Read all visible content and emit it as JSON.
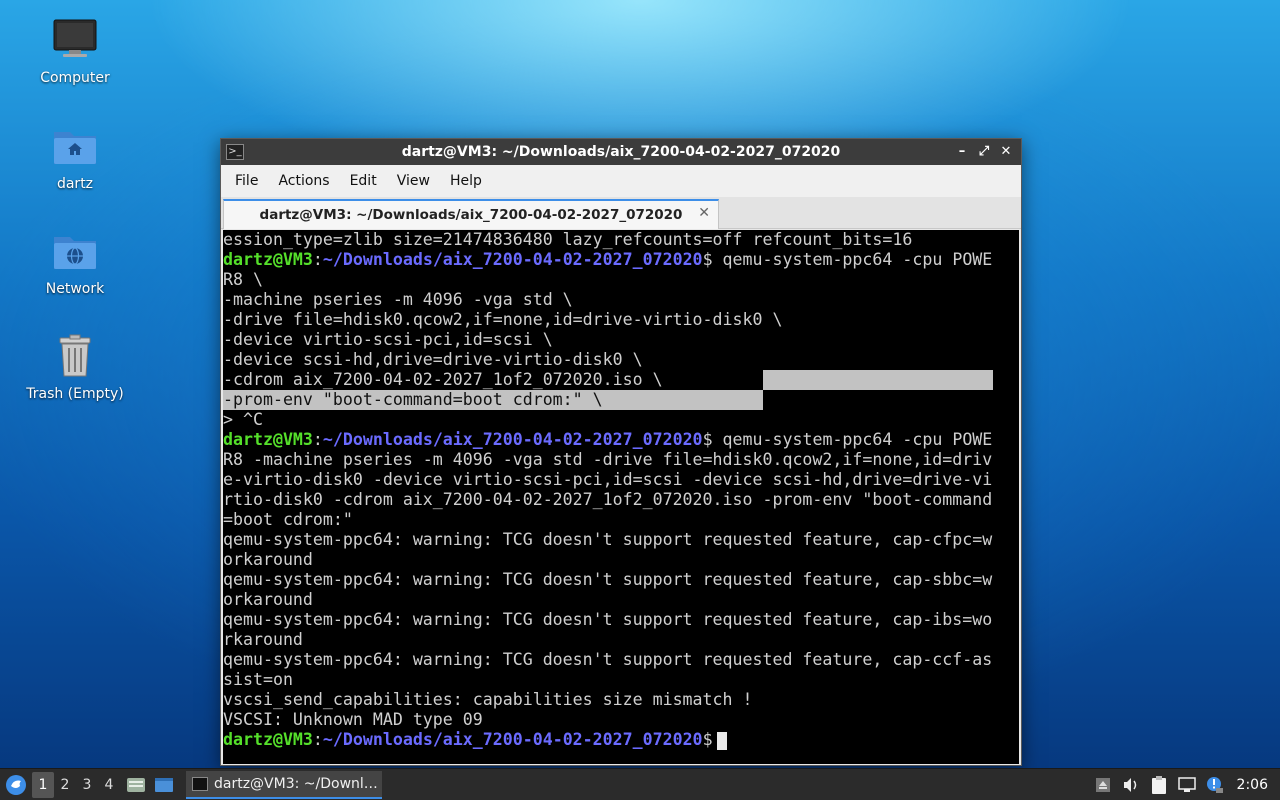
{
  "desktop": {
    "icons": [
      {
        "label": "Computer",
        "icon": "computer-icon"
      },
      {
        "label": "dartz",
        "icon": "home-folder-icon"
      },
      {
        "label": "Network",
        "icon": "network-folder-icon"
      },
      {
        "label": "Trash (Empty)",
        "icon": "trash-icon"
      }
    ]
  },
  "window": {
    "title": "dartz@VM3: ~/Downloads/aix_7200-04-02-2027_072020",
    "controls": {
      "minimize": "–",
      "maximize": "⤢",
      "close": "✕"
    },
    "menu": [
      "File",
      "Actions",
      "Edit",
      "View",
      "Help"
    ],
    "tab": {
      "label": "dartz@VM3: ~/Downloads/aix_7200-04-02-2027_072020",
      "close": "✕"
    }
  },
  "terminal": {
    "user": "dartz@VM3",
    "path": "~/Downloads/aix_7200-04-02-2027_072020",
    "lines": {
      "l0": "ession_type=zlib size=21474836480 lazy_refcounts=off refcount_bits=16",
      "l1_cmd": " qemu-system-ppc64 -cpu POWE",
      "l2": "R8 \\",
      "l3": "-machine pseries -m 4096 -vga std \\",
      "l4": "-drive file=hdisk0.qcow2,if=none,id=drive-virtio-disk0 \\",
      "l5": "-device virtio-scsi-pci,id=scsi \\",
      "l6": "-device scsi-hd,drive=drive-virtio-disk0 \\",
      "l7": "-cdrom aix_7200-04-02-2027_1of2_072020.iso \\",
      "l8": "-prom-env \"boot-command=boot cdrom:\" \\",
      "l9": "> ^C",
      "l10_cmd": " qemu-system-ppc64 -cpu POWE",
      "l11": "R8 -machine pseries -m 4096 -vga std -drive file=hdisk0.qcow2,if=none,id=driv",
      "l12": "e-virtio-disk0 -device virtio-scsi-pci,id=scsi -device scsi-hd,drive=drive-vi",
      "l13": "rtio-disk0 -cdrom aix_7200-04-02-2027_1of2_072020.iso -prom-env \"boot-command",
      "l14": "=boot cdrom:\"",
      "l15": "qemu-system-ppc64: warning: TCG doesn't support requested feature, cap-cfpc=w",
      "l16": "orkaround",
      "l17": "qemu-system-ppc64: warning: TCG doesn't support requested feature, cap-sbbc=w",
      "l18": "orkaround",
      "l19": "qemu-system-ppc64: warning: TCG doesn't support requested feature, cap-ibs=wo",
      "l20": "rkaround",
      "l21": "qemu-system-ppc64: warning: TCG doesn't support requested feature, cap-ccf-as",
      "l22": "sist=on",
      "l23": "vscsi_send_capabilities: capabilities size mismatch !",
      "l24": "VSCSI: Unknown MAD type 09",
      "prompt_suffix": ":",
      "dollar": "$"
    }
  },
  "taskbar": {
    "workspaces": [
      "1",
      "2",
      "3",
      "4"
    ],
    "active_workspace": "1",
    "task_label": "dartz@VM3: ~/Downl…",
    "clock": "2:06",
    "accent": "#3d8ee8"
  },
  "colors": {
    "prompt_user": "#55e02a",
    "prompt_path": "#6b6bff",
    "selection": "#c2c2c2"
  }
}
